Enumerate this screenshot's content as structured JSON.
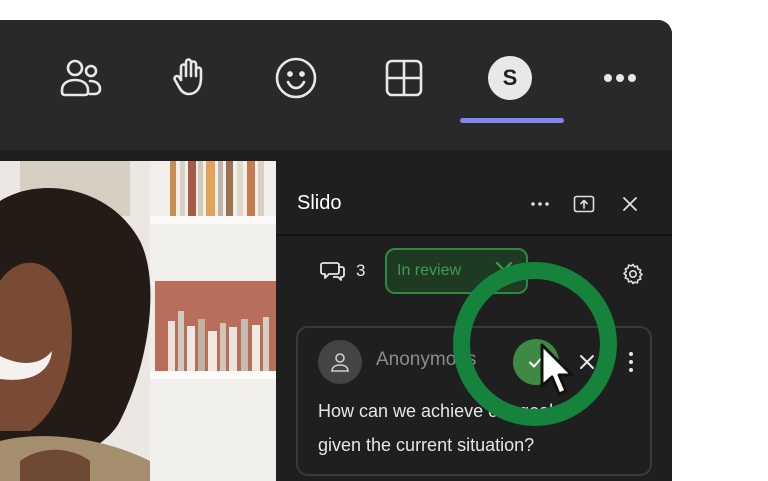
{
  "toolbar": {
    "items": [
      {
        "name": "people",
        "icon": "people-icon"
      },
      {
        "name": "raise-hand",
        "icon": "raise-hand-icon"
      },
      {
        "name": "reactions",
        "icon": "smile-icon"
      },
      {
        "name": "view",
        "icon": "grid-icon"
      },
      {
        "name": "slido",
        "icon": "slido-s-icon",
        "letter": "S",
        "active": true
      },
      {
        "name": "more",
        "icon": "more-horizontal-icon"
      }
    ],
    "accent_color": "#7f85f5"
  },
  "panel": {
    "title": "Slido",
    "comments_count": "3",
    "review_chip_label": "In review",
    "question": {
      "author": "Anonymous",
      "text": "How can we achieve our goals given the current situation?"
    }
  },
  "colors": {
    "approve_green": "#3f8a43",
    "highlight_green": "#16833d",
    "chip_green": "#3f9c4d"
  }
}
